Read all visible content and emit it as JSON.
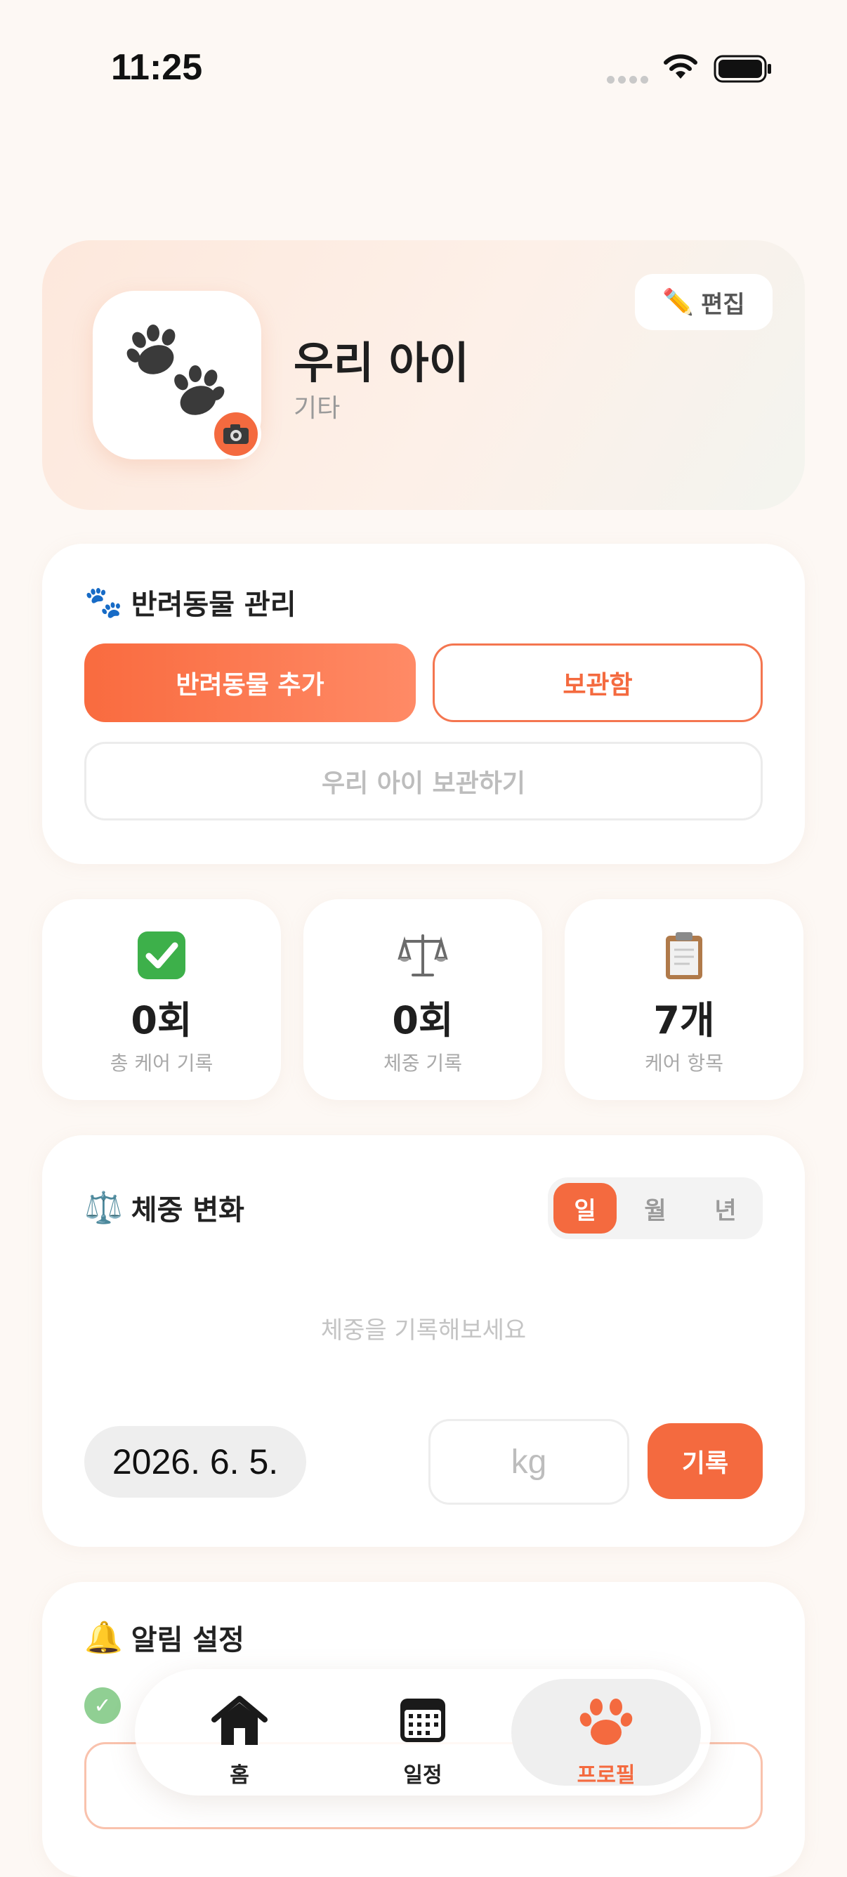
{
  "status_bar": {
    "time": "11:25"
  },
  "profile": {
    "name": "우리 아이",
    "type": "기타",
    "edit_label": "편집",
    "avatar_icon": "paw-prints-icon",
    "camera_icon": "camera-icon"
  },
  "pet_management": {
    "title": "반려동물 관리",
    "add_label": "반려동물 추가",
    "archive_box_label": "보관함",
    "archive_pet_label": "우리 아이 보관하기"
  },
  "stats": [
    {
      "icon": "checkmark-icon",
      "value": "0회",
      "label": "총 케어 기록"
    },
    {
      "icon": "scale-icon",
      "value": "0회",
      "label": "체중 기록"
    },
    {
      "icon": "clipboard-icon",
      "value": "7개",
      "label": "케어 항목"
    }
  ],
  "weight": {
    "title": "체중 변화",
    "periods": [
      "일",
      "월",
      "년"
    ],
    "selected_period": "일",
    "empty_text": "체중을 기록해보세요",
    "date": "2026. 6. 5.",
    "input_placeholder": "kg",
    "record_label": "기록"
  },
  "alarm": {
    "title": "알림 설정"
  },
  "tab_bar": {
    "tabs": [
      {
        "label": "홈",
        "icon": "home-icon"
      },
      {
        "label": "일정",
        "icon": "calendar-icon"
      },
      {
        "label": "프로필",
        "icon": "paw-icon"
      }
    ],
    "active": "프로필"
  },
  "colors": {
    "accent": "#f46a3f",
    "background": "#fdf8f4",
    "success": "#6cc070"
  }
}
